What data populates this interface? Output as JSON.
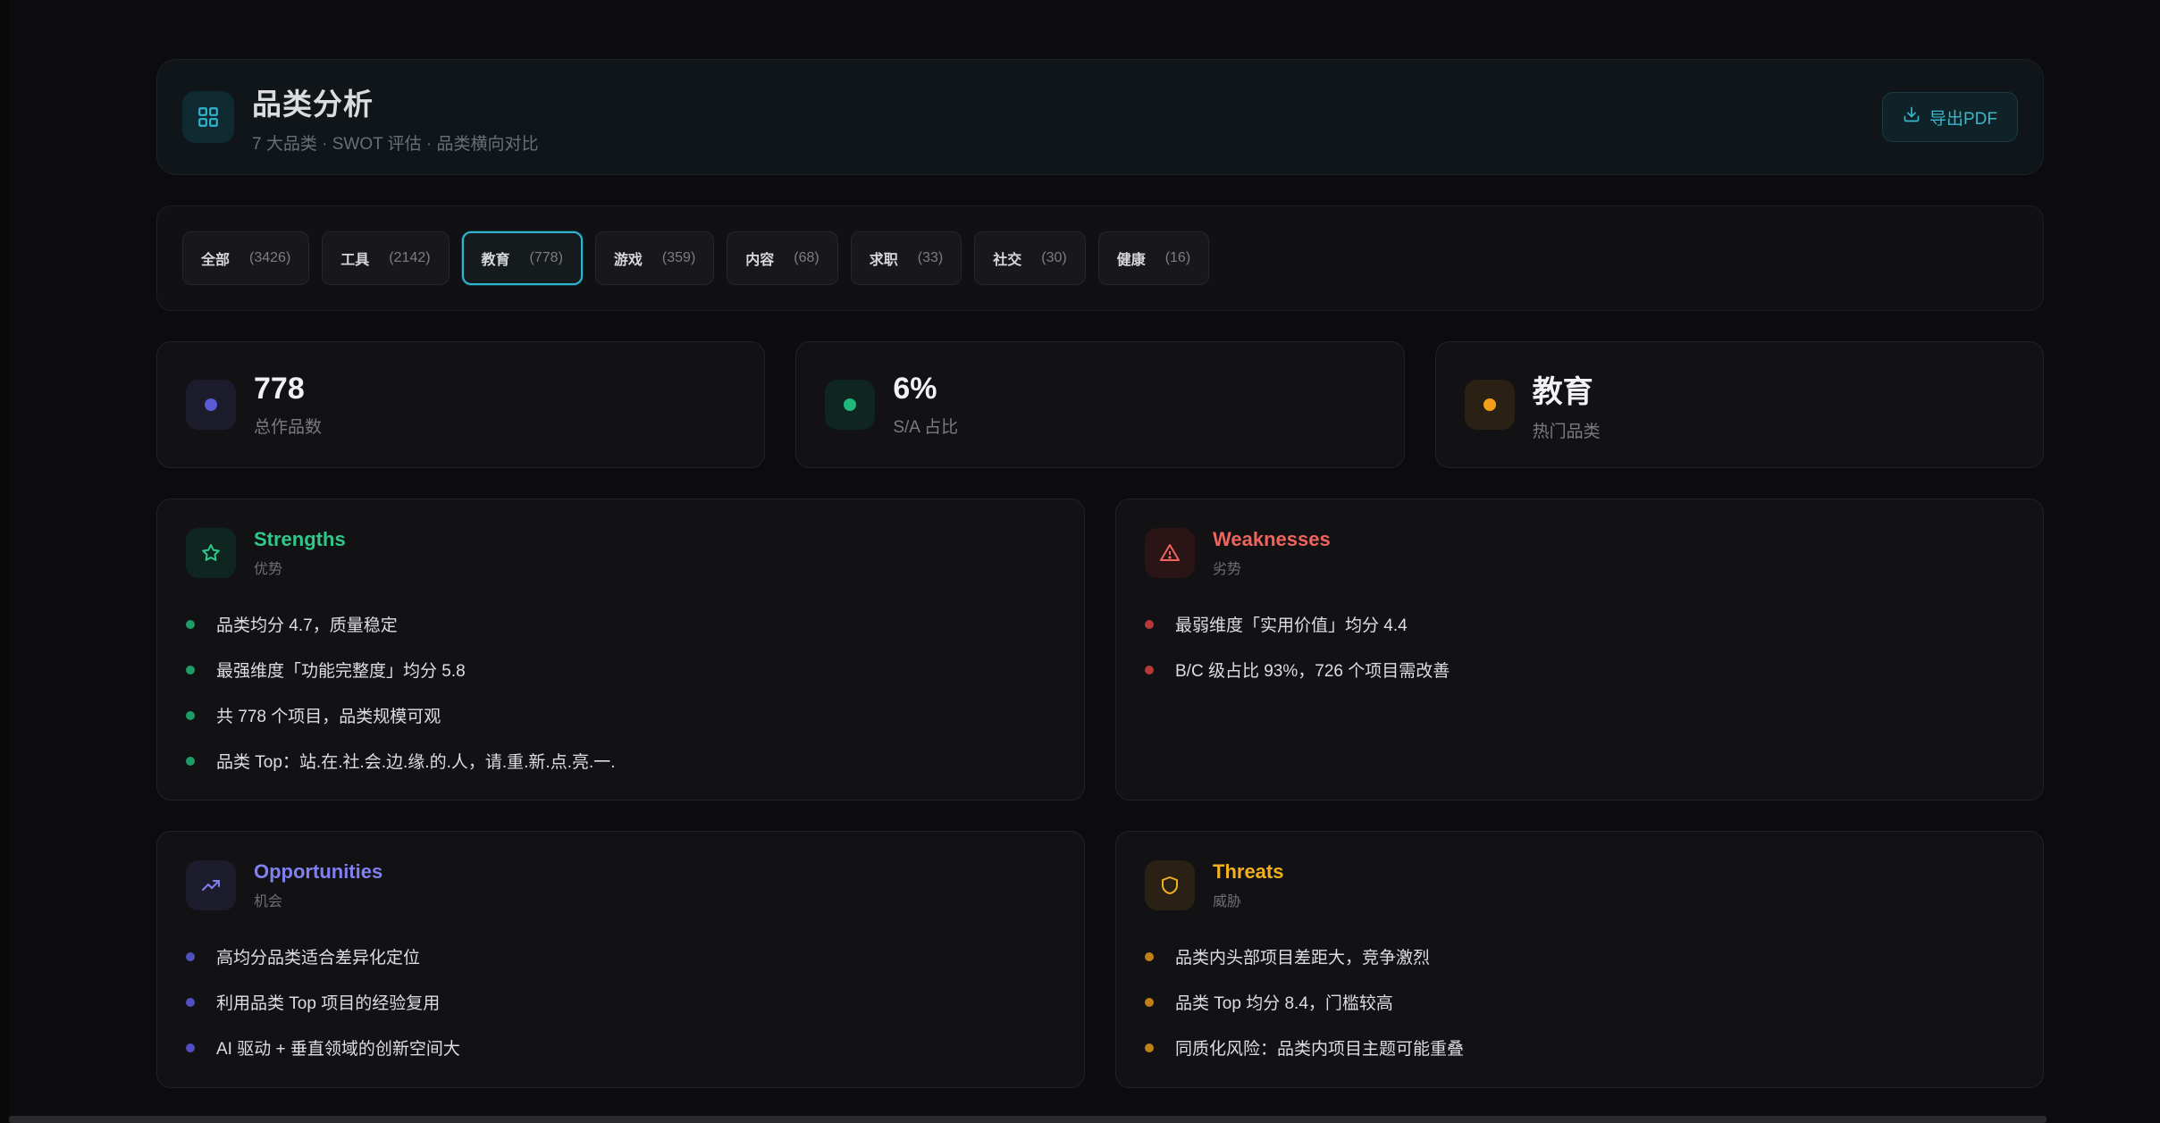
{
  "header": {
    "title": "品类分析",
    "subtitle": "7 大品类 · SWOT 评估 · 品类横向对比",
    "export_label": "导出PDF"
  },
  "tabs": [
    {
      "label": "全部",
      "count": "(3426)",
      "active": false
    },
    {
      "label": "工具",
      "count": "(2142)",
      "active": false
    },
    {
      "label": "教育",
      "count": "(778)",
      "active": true
    },
    {
      "label": "游戏",
      "count": "(359)",
      "active": false
    },
    {
      "label": "内容",
      "count": "(68)",
      "active": false
    },
    {
      "label": "求职",
      "count": "(33)",
      "active": false
    },
    {
      "label": "社交",
      "count": "(30)",
      "active": false
    },
    {
      "label": "健康",
      "count": "(16)",
      "active": false
    }
  ],
  "stats": [
    {
      "value": "778",
      "label": "总作品数",
      "color": "#5b5bd6",
      "bg": "#1c1c2c"
    },
    {
      "value": "6%",
      "label": "S/A 占比",
      "color": "#1fb77a",
      "bg": "#0f2620"
    },
    {
      "value": "教育",
      "label": "热门品类",
      "color": "#f2a01a",
      "bg": "#2a2014"
    }
  ],
  "swot": {
    "strengths": {
      "title": "Strengths",
      "subtitle": "优势",
      "color": "#2ec98a",
      "items": [
        "品类均分 4.7，质量稳定",
        "最强维度「功能完整度」均分 5.8",
        "共 778 个项目，品类规模可观",
        "品类 Top：站.在.社.会.边.缘.的.人，请.重.新.点.亮.一."
      ]
    },
    "weaknesses": {
      "title": "Weaknesses",
      "subtitle": "劣势",
      "color": "#f0645e",
      "items": [
        "最弱维度「实用价值」均分 4.4",
        "B/C 级占比 93%，726 个项目需改善"
      ]
    },
    "opportunities": {
      "title": "Opportunities",
      "subtitle": "机会",
      "color": "#8080f0",
      "items": [
        "高均分品类适合差异化定位",
        "利用品类 Top 项目的经验复用",
        "AI 驱动 + 垂直领域的创新空间大"
      ]
    },
    "threats": {
      "title": "Threats",
      "subtitle": "威胁",
      "color": "#f2b020",
      "items": [
        "品类内头部项目差距大，竞争激烈",
        "品类 Top 均分 8.4，门槛较高",
        "同质化风险：品类内项目主题可能重叠"
      ]
    }
  }
}
